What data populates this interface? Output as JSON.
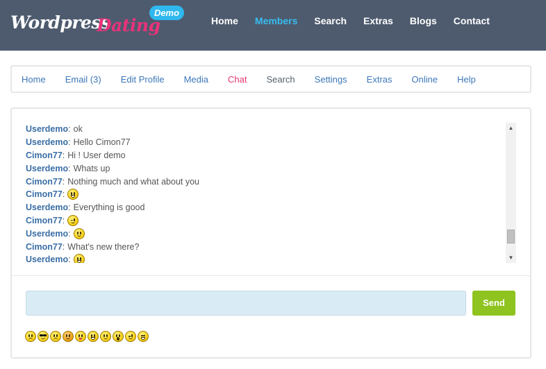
{
  "brand": {
    "name_part1": "Wordpress",
    "name_part2": "Dating",
    "badge": "Demo",
    "colors": {
      "header_bg": "#4e5b6e",
      "accent_blue": "#37bdf0",
      "accent_pink": "#e8337b",
      "send_green": "#8fc31f"
    }
  },
  "topnav": {
    "items": [
      {
        "label": "Home"
      },
      {
        "label": "Members",
        "active": true
      },
      {
        "label": "Search"
      },
      {
        "label": "Extras"
      },
      {
        "label": "Blogs"
      },
      {
        "label": "Contact"
      }
    ]
  },
  "subnav": {
    "items": [
      {
        "label": "Home"
      },
      {
        "label": "Email (3)"
      },
      {
        "label": "Edit Profile"
      },
      {
        "label": "Media"
      },
      {
        "label": "Chat",
        "active": true
      },
      {
        "label": "Search"
      },
      {
        "label": "Settings"
      },
      {
        "label": "Extras"
      },
      {
        "label": "Online"
      },
      {
        "label": "Help"
      }
    ]
  },
  "chat": {
    "messages": [
      {
        "user": "Userdemo",
        "text": "ok",
        "emoticon": null
      },
      {
        "user": "Userdemo",
        "text": "Hello Cimon77",
        "emoticon": null
      },
      {
        "user": "Cimon77",
        "text": "Hi ! User demo",
        "emoticon": null
      },
      {
        "user": "Userdemo",
        "text": "Whats up",
        "emoticon": null
      },
      {
        "user": "Cimon77",
        "text": "Nothing much and what about you",
        "emoticon": null
      },
      {
        "user": "Cimon77",
        "text": "",
        "emoticon": "big-grin-smiley-icon"
      },
      {
        "user": "Userdemo",
        "text": "Everything is good",
        "emoticon": null
      },
      {
        "user": "Cimon77",
        "text": "",
        "emoticon": "wink-smiley-icon"
      },
      {
        "user": "Userdemo",
        "text": "",
        "emoticon": "smile-smiley-icon"
      },
      {
        "user": "Cimon77",
        "text": "What's new there?",
        "emoticon": null
      },
      {
        "user": "Userdemo",
        "text": "",
        "emoticon": "big-grin-smiley-icon"
      }
    ],
    "input_value": "",
    "send_label": "Send",
    "emoticons": [
      "confused-smiley-icon",
      "cool-smiley-icon",
      "sad-smiley-icon",
      "angry-smiley-icon",
      "tongue-smiley-icon",
      "big-grin-smiley-icon",
      "smile-smiley-icon",
      "surprised-smiley-icon",
      "wink-smiley-icon",
      "laugh-smiley-icon"
    ]
  }
}
